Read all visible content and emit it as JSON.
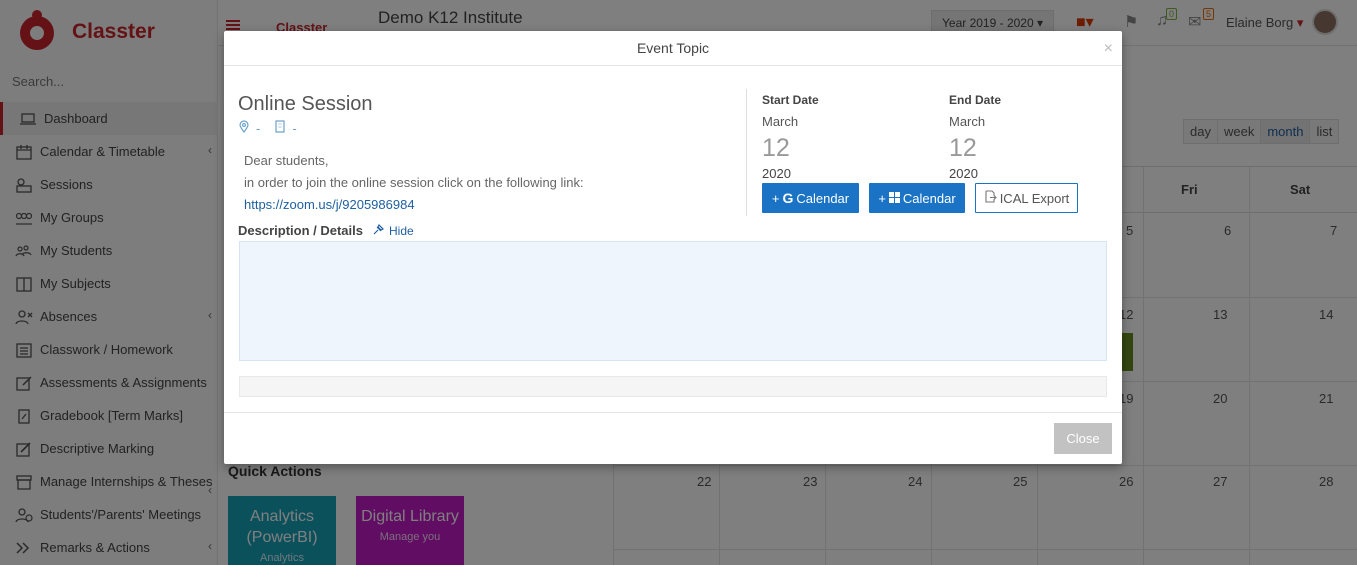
{
  "app": {
    "brand": "Classter",
    "institute": "Demo K12 Institute",
    "year_select": "Year 2019 - 2020",
    "user_name": "Elaine Borg",
    "notif_count": "0",
    "mail_count": "5"
  },
  "sidebar": {
    "search_placeholder": "Search...",
    "items": [
      {
        "label": "Dashboard",
        "icon": "laptop-icon"
      },
      {
        "label": "Calendar & Timetable",
        "icon": "calendar-icon"
      },
      {
        "label": "Sessions",
        "icon": "sessions-icon"
      },
      {
        "label": "My Groups",
        "icon": "groups-icon"
      },
      {
        "label": "My Students",
        "icon": "students-icon"
      },
      {
        "label": "My Subjects",
        "icon": "book-icon"
      },
      {
        "label": "Absences",
        "icon": "user-x-icon"
      },
      {
        "label": "Classwork / Homework",
        "icon": "list-icon"
      },
      {
        "label": "Assessments & Assignments",
        "icon": "edit-icon"
      },
      {
        "label": "Gradebook [Term Marks]",
        "icon": "gradebook-icon"
      },
      {
        "label": "Descriptive Marking",
        "icon": "pencil-icon"
      },
      {
        "label": "Manage Internships & Theses",
        "icon": "archive-icon"
      },
      {
        "label": "Students'/Parents' Meetings",
        "icon": "meeting-icon"
      },
      {
        "label": "Remarks & Actions",
        "icon": "remarks-icon"
      }
    ]
  },
  "calendar": {
    "views": [
      "day",
      "week",
      "month",
      "list"
    ],
    "active_view": "month",
    "day_headers": [
      "Fri",
      "Sat"
    ],
    "rows": [
      [
        "5",
        "6",
        "7"
      ],
      [
        "12",
        "13",
        "14"
      ],
      [
        "19",
        "20",
        "21"
      ],
      [
        "22",
        "23",
        "24",
        "25",
        "26",
        "27",
        "28"
      ]
    ]
  },
  "quick_actions": {
    "title": "Quick Actions",
    "tiles": [
      {
        "title": "Analytics (PowerBI)",
        "sub": "Analytics"
      },
      {
        "title": "Digital Library",
        "sub": "Manage you"
      }
    ]
  },
  "modal": {
    "title": "Event Topic",
    "event_title": "Online Session",
    "location": "-",
    "room": "-",
    "body_line1": "Dear students,",
    "body_line2": "in order to join the online session click on the following link:",
    "link": "https://zoom.us/j/9205986984",
    "desc_label": "Description / Details",
    "hide_label": "Hide",
    "start_label": "Start Date",
    "end_label": "End Date",
    "start": {
      "month": "March",
      "day": "12",
      "year": "2020"
    },
    "end": {
      "month": "March",
      "day": "12",
      "year": "2020"
    },
    "gcal_label": "Calendar",
    "wcal_label": "Calendar",
    "ical_label": "ICAL Export",
    "close_label": "Close"
  }
}
